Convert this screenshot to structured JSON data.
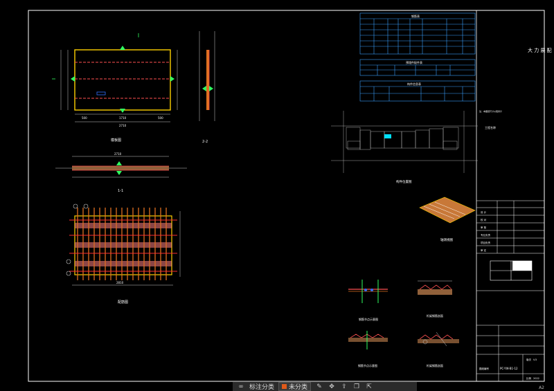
{
  "colors": {
    "background": "#000000",
    "frame": "#ffffff",
    "slab_fill": "#f0a060",
    "rebar_red": "#ff3030",
    "rebar_orange": "#e07020",
    "dim_green": "#30ff60",
    "dim_line": "#cccccc",
    "pink_band": "#ff8080",
    "cyan_highlight": "#00e0ff",
    "yellow_outline": "#ffd000",
    "toolbar_bg": "#2b2b2b",
    "layer_swatch": "#e05a1a"
  },
  "drawing": {
    "title_block_vertical": "大 力 展 配",
    "view_plan_title": "模板图",
    "view_section_11": "1-1",
    "view_section_22": "2-2",
    "view_rebar_title": "配筋图",
    "location_plan_title": "构件位置图",
    "iso_view_title": "轴测视图",
    "detail_1_title": "钢筋节点示意图",
    "detail_2_title": "桁架钢筋剖面",
    "detail_3_title": "钢筋节点示意图",
    "detail_4_title": "桁架钢筋剖面",
    "dim_overall_width": "2710",
    "dim_left_seg": "500",
    "dim_right_seg": "500",
    "dim_mid_seg": "1710",
    "dim_height": "1590",
    "dim_section_top": "2710",
    "dim_rebar_bottom": "2810",
    "revision_label": "版次",
    "revision_value": "V.5",
    "drawing_no_label": "图纸编号",
    "drawing_no_value": "PC-YW-B1-12",
    "scale_label": "比例",
    "scale_value": "2022",
    "sheet_size": "A2",
    "table_steel_title": "钢筋表",
    "table_embed_title": "预埋件配件表",
    "table_member_title": "构件信息表",
    "titleblock_note": "注：本图纸尺寸以毫米计",
    "titleblock_project_label": "工程名称",
    "titleblock_row_labels": [
      "设 计",
      "校 对",
      "审 核",
      "专业负责",
      "项目负责",
      "审 定"
    ]
  },
  "toolbar": {
    "annotate_label": "标注分类",
    "layer_label": "未分类",
    "icons": [
      "glasses-icon",
      "pencil-icon",
      "move-icon",
      "share-icon",
      "copy-icon",
      "export-icon"
    ]
  }
}
